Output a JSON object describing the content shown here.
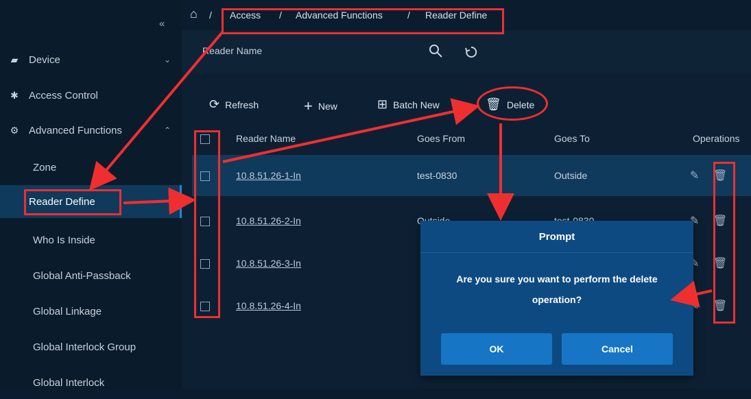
{
  "sidebar": {
    "collapse_glyph": "«",
    "groups": [
      {
        "label": "Device",
        "icon": "device-icon",
        "chevron": "⌄"
      },
      {
        "label": "Access Control",
        "icon": "gear-icon",
        "chevron": ""
      },
      {
        "label": "Advanced Functions",
        "icon": "advanced-icon",
        "chevron": "⌃"
      }
    ],
    "items": [
      {
        "label": "Zone"
      },
      {
        "label": "Reader Define",
        "active": true
      },
      {
        "label": "Who Is Inside"
      },
      {
        "label": "Global Anti-Passback"
      },
      {
        "label": "Global Linkage"
      },
      {
        "label": "Global Interlock Group"
      },
      {
        "label": "Global Interlock"
      }
    ]
  },
  "breadcrumb": {
    "home_icon": "home-icon",
    "sep": "/",
    "items": [
      "Access",
      "Advanced Functions",
      "Reader Define"
    ]
  },
  "filter": {
    "label": "Reader Name",
    "search_icon": "search-icon",
    "reset_icon": "reset-icon"
  },
  "toolbar": {
    "refresh": "Refresh",
    "new": "New",
    "batch_new": "Batch New",
    "delete": "Delete"
  },
  "table": {
    "columns": [
      "Reader Name",
      "Goes From",
      "Goes To",
      "Operations"
    ],
    "rows": [
      {
        "name": "10.8.51.26-1-In",
        "from": "test-0830",
        "to": "Outside"
      },
      {
        "name": "10.8.51.26-2-In",
        "from": "Outside",
        "to": "test-0830"
      },
      {
        "name": "10.8.51.26-3-In",
        "from": "",
        "to": ""
      },
      {
        "name": "10.8.51.26-4-In",
        "from": "",
        "to": ""
      }
    ]
  },
  "dialog": {
    "title": "Prompt",
    "message": "Are you sure you want to perform the delete operation?",
    "ok": "OK",
    "cancel": "Cancel"
  },
  "colors": {
    "annotation_red": "#ef2f2f",
    "accent": "#1675c5",
    "selected_row": "#0f3a5c"
  }
}
